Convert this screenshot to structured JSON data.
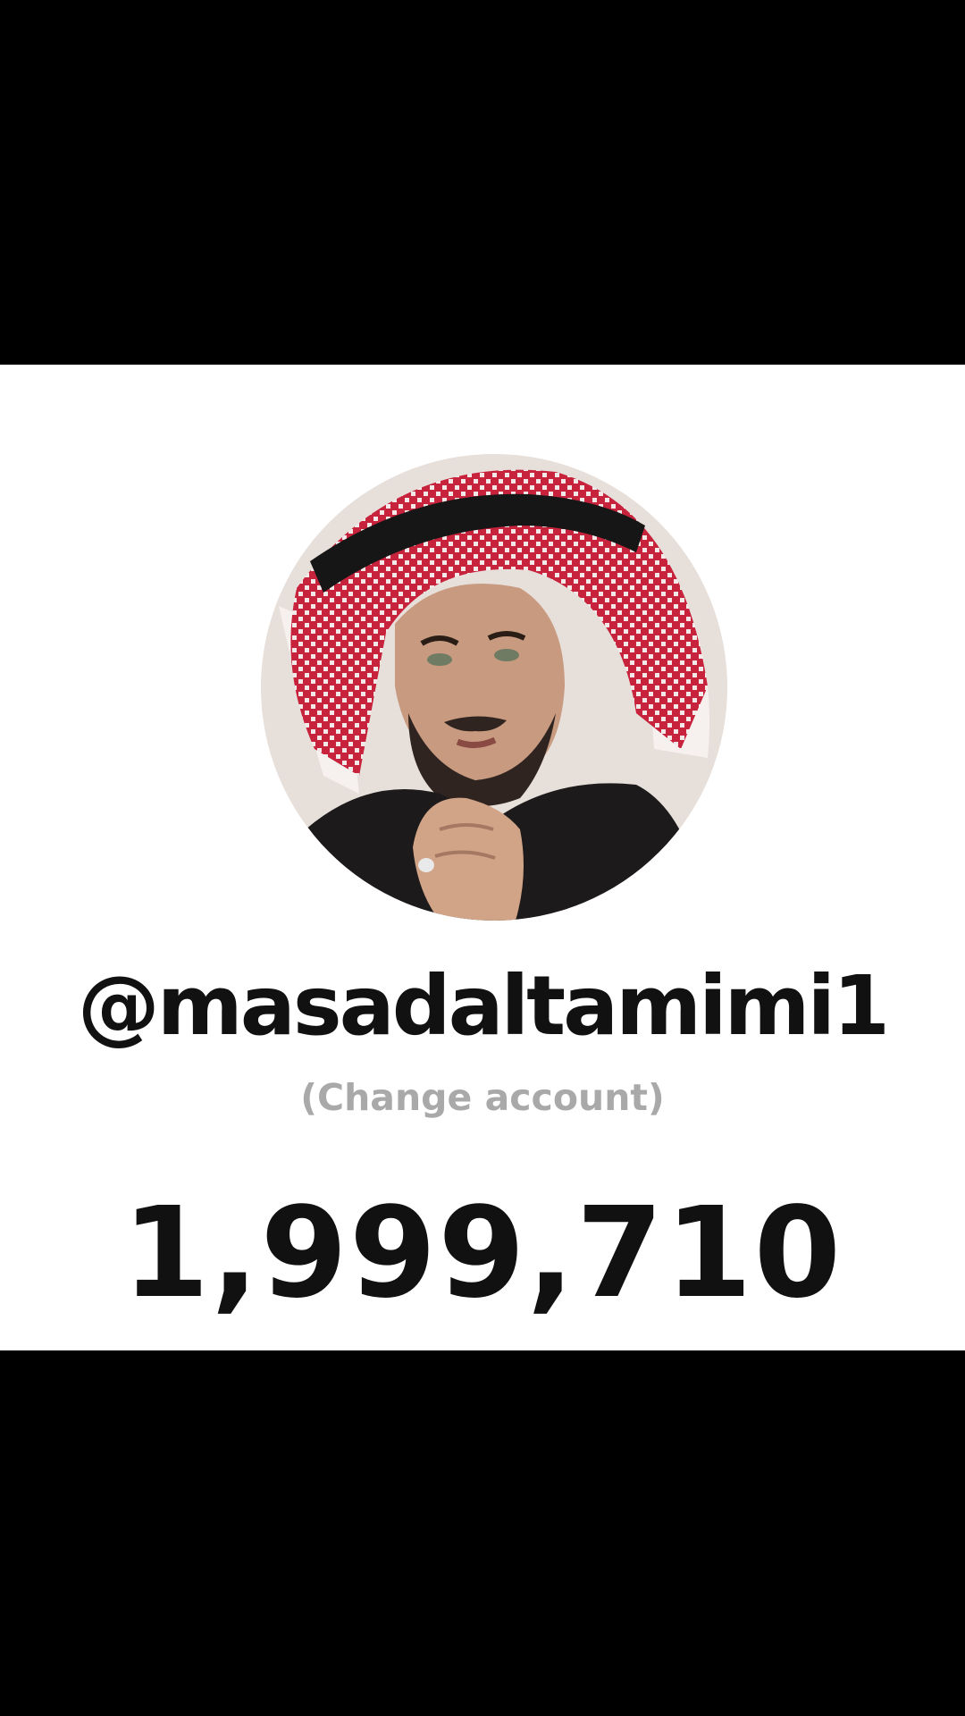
{
  "profile": {
    "username": "@masadaltamimi1",
    "change_account_label": "(Change account)",
    "count": "1,999,710",
    "avatar_description_icon": "profile-photo"
  },
  "colors": {
    "panel_background": "#ffffff",
    "letterbox": "#000000",
    "username_text": "#111111",
    "secondary_text": "#a9a9a9",
    "count_text": "#111111"
  }
}
